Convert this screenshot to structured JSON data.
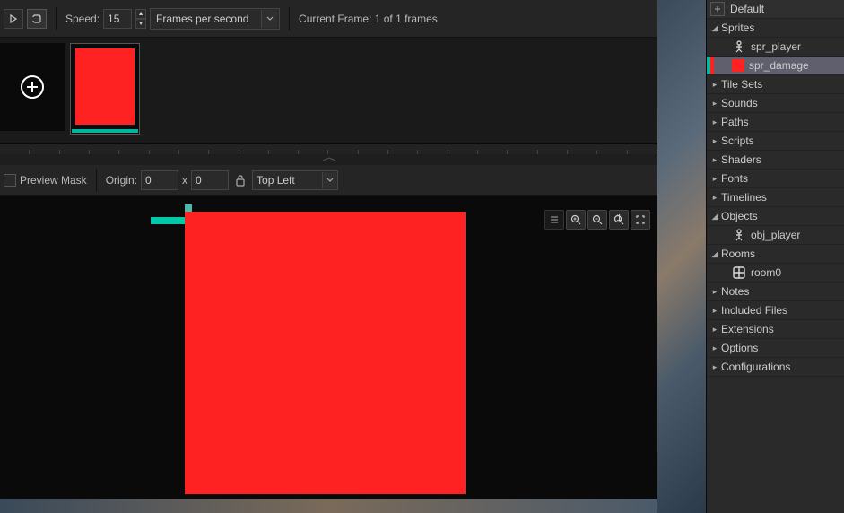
{
  "toolbar": {
    "speed_label": "Speed:",
    "speed_value": "15",
    "fps_label": "Frames per second",
    "current_frame_label": "Current Frame: 1 of 1 frames"
  },
  "origin_bar": {
    "preview_mask_label": "Preview Mask",
    "origin_label": "Origin:",
    "origin_x": "0",
    "origin_xy_sep": "x",
    "origin_y": "0",
    "origin_mode": "Top Left"
  },
  "sidebar": {
    "default_label": "Default",
    "items": [
      {
        "label": "Sprites",
        "type": "folder",
        "expanded": true
      },
      {
        "label": "spr_player",
        "type": "sprite-person",
        "indent": 1
      },
      {
        "label": "spr_damage",
        "type": "sprite-red",
        "indent": 1,
        "selected": true
      },
      {
        "label": "Tile Sets",
        "type": "folder",
        "expanded": false
      },
      {
        "label": "Sounds",
        "type": "folder",
        "expanded": false
      },
      {
        "label": "Paths",
        "type": "folder",
        "expanded": false
      },
      {
        "label": "Scripts",
        "type": "folder",
        "expanded": false
      },
      {
        "label": "Shaders",
        "type": "folder",
        "expanded": false
      },
      {
        "label": "Fonts",
        "type": "folder",
        "expanded": false
      },
      {
        "label": "Timelines",
        "type": "folder",
        "expanded": false
      },
      {
        "label": "Objects",
        "type": "folder",
        "expanded": true
      },
      {
        "label": "obj_player",
        "type": "sprite-person",
        "indent": 1
      },
      {
        "label": "Rooms",
        "type": "folder",
        "expanded": true
      },
      {
        "label": "room0",
        "type": "room",
        "indent": 1
      },
      {
        "label": "Notes",
        "type": "folder",
        "expanded": false
      },
      {
        "label": "Included Files",
        "type": "folder",
        "expanded": false
      },
      {
        "label": "Extensions",
        "type": "folder",
        "expanded": false
      },
      {
        "label": "Options",
        "type": "folder",
        "expanded": false
      },
      {
        "label": "Configurations",
        "type": "folder",
        "expanded": false
      }
    ]
  }
}
